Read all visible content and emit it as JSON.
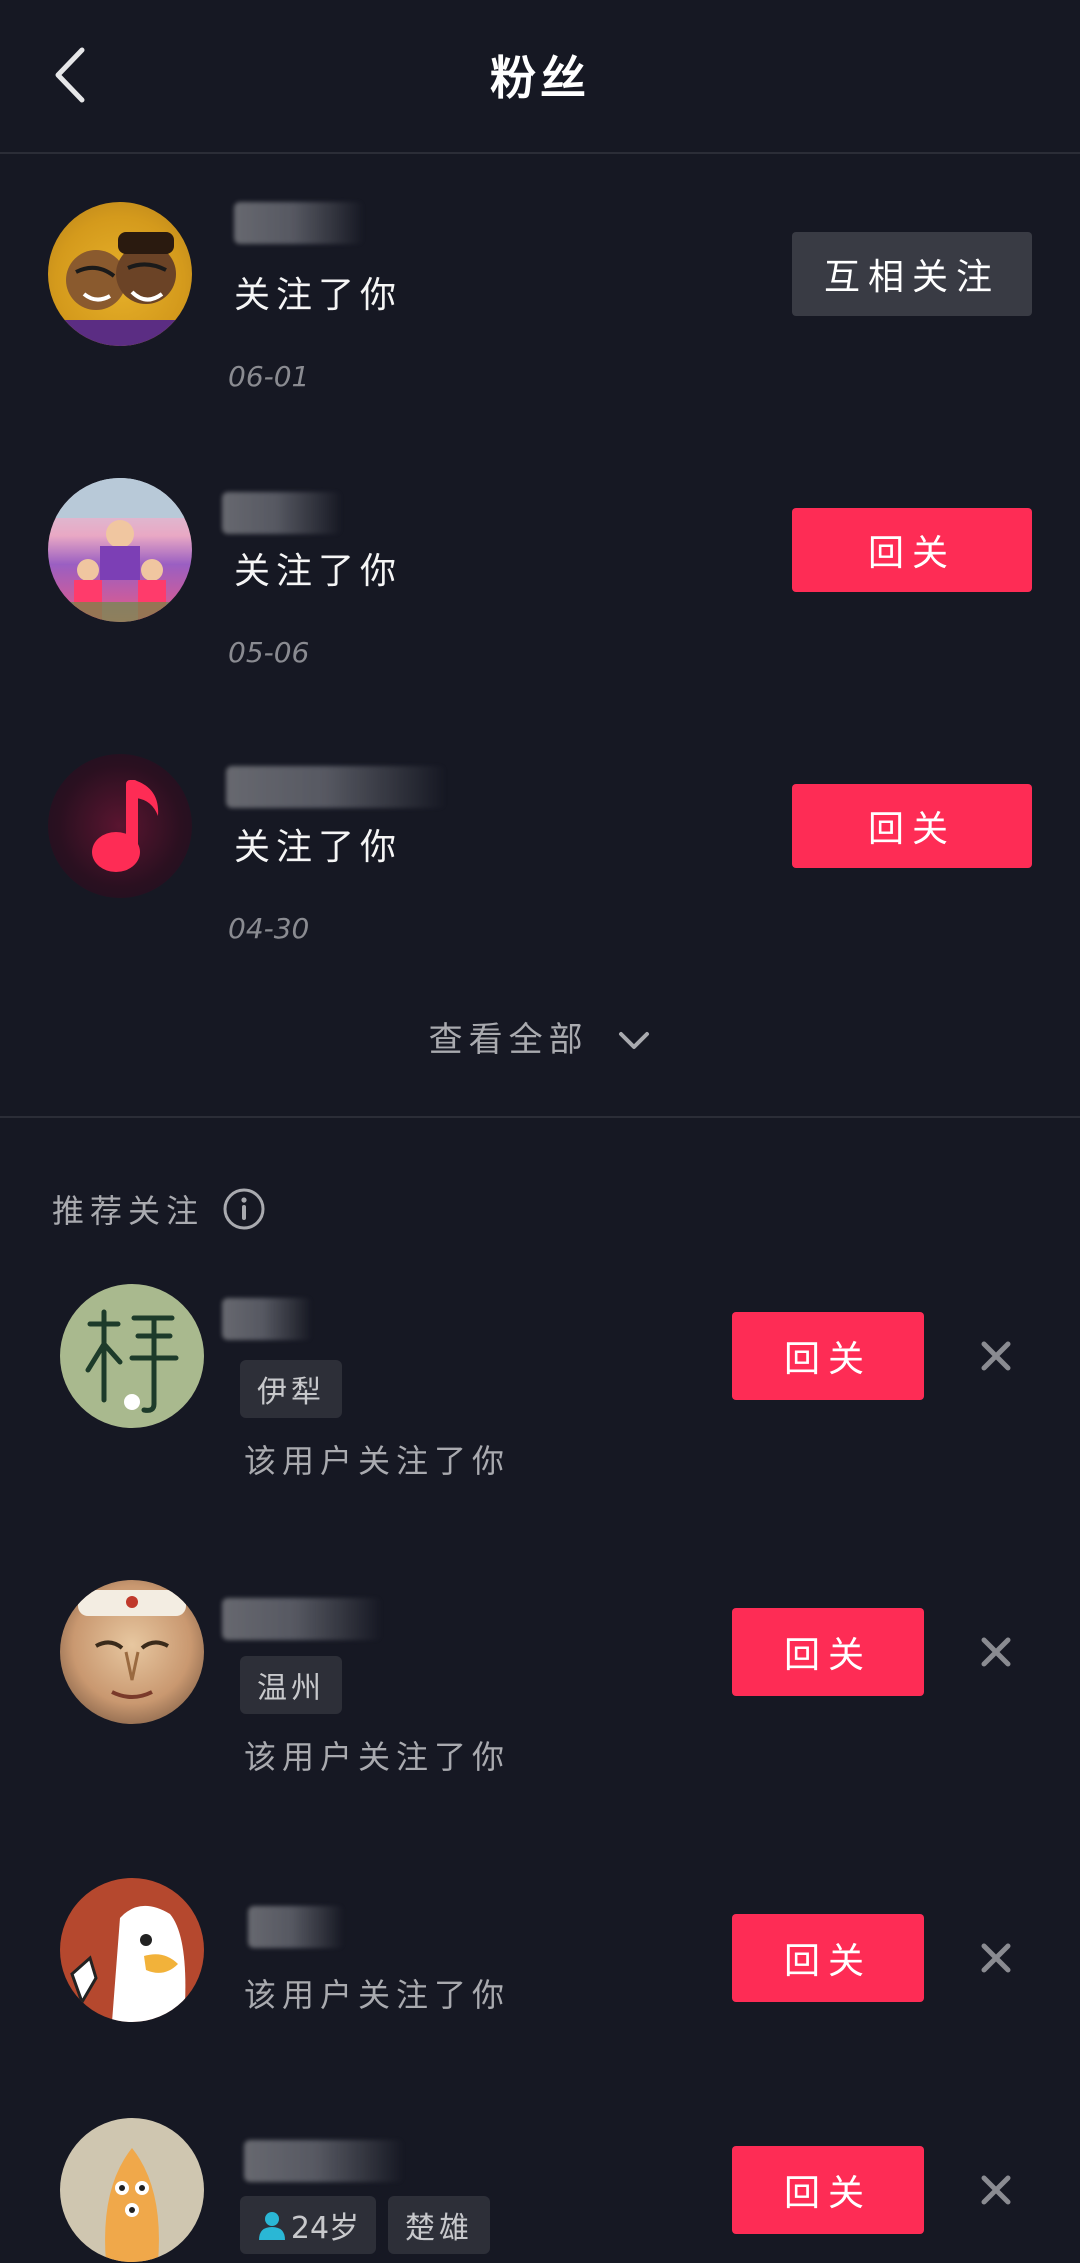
{
  "header": {
    "title": "粉丝",
    "back_icon": "chevron-left-icon"
  },
  "fans": [
    {
      "action": "关注了你",
      "date": "06-01",
      "button": "互相关注",
      "button_style": "gray"
    },
    {
      "action": "关注了你",
      "date": "05-06",
      "button": "回关",
      "button_style": "red"
    },
    {
      "action": "关注了你",
      "date": "04-30",
      "button": "回关",
      "button_style": "red"
    }
  ],
  "see_all": {
    "label": "查看全部",
    "icon": "chevron-down-icon"
  },
  "recommend": {
    "title": "推荐关注",
    "info_icon": "info-circle-icon",
    "items": [
      {
        "tags": [
          "伊犁"
        ],
        "desc": "该用户关注了你",
        "button": "回关"
      },
      {
        "tags": [
          "温州"
        ],
        "desc": "该用户关注了你",
        "button": "回关"
      },
      {
        "tags": [],
        "desc": "该用户关注了你",
        "button": "回关"
      },
      {
        "tags": [
          "24岁",
          "楚雄"
        ],
        "desc": "",
        "button": "回关"
      }
    ]
  },
  "colors": {
    "background": "#161823",
    "accent": "#fe2c55",
    "secondary_button": "#393b44"
  }
}
